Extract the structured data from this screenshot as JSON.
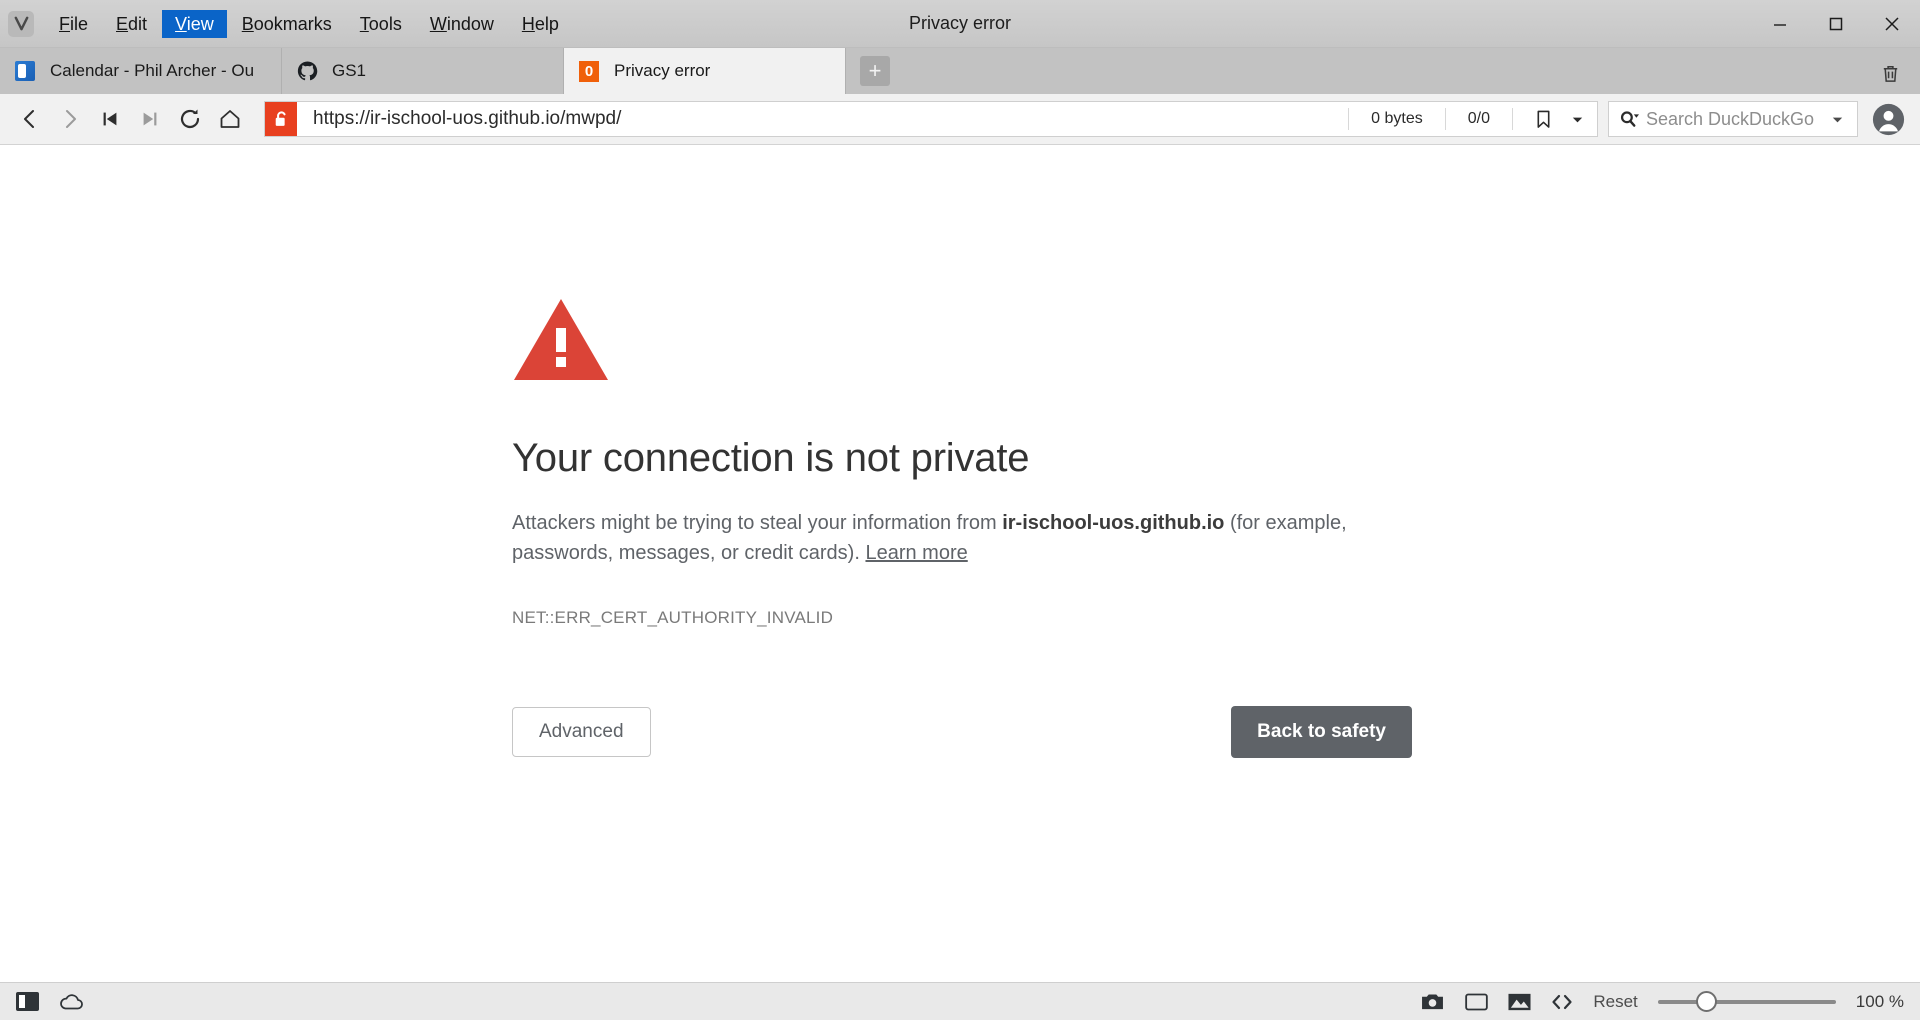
{
  "window": {
    "title": "Privacy error",
    "minimize_label": "Minimize",
    "maximize_label": "Maximize",
    "close_label": "Close"
  },
  "menubar": {
    "logo_icon": "vivaldi-logo-icon",
    "items": [
      {
        "label": "File",
        "mnemonic": "F",
        "rest": "ile",
        "active": false
      },
      {
        "label": "Edit",
        "mnemonic": "E",
        "rest": "dit",
        "active": false
      },
      {
        "label": "View",
        "mnemonic": "V",
        "rest": "iew",
        "active": true
      },
      {
        "label": "Bookmarks",
        "mnemonic": "B",
        "rest": "ookmarks",
        "active": false
      },
      {
        "label": "Tools",
        "mnemonic": "T",
        "rest": "ools",
        "active": false
      },
      {
        "label": "Window",
        "mnemonic": "W",
        "rest": "indow",
        "active": false
      },
      {
        "label": "Help",
        "mnemonic": "H",
        "rest": "elp",
        "active": false
      }
    ]
  },
  "tabs": {
    "items": [
      {
        "title": "Calendar - Phil Archer - Ou",
        "favicon": "outlook-icon",
        "active": false
      },
      {
        "title": "GS1",
        "favicon": "github-icon",
        "active": false
      },
      {
        "title": "Privacy error",
        "favicon": "orange-zero-icon",
        "active": true
      }
    ],
    "new_tab_label": "+",
    "trash_icon": "trash-icon"
  },
  "toolbar": {
    "back_icon": "back-arrow-icon",
    "forward_icon": "forward-arrow-icon",
    "rewind_icon": "rewind-icon",
    "fastforward_icon": "fast-forward-icon",
    "reload_icon": "reload-icon",
    "home_icon": "home-icon",
    "ssl_icon": "open-padlock-icon",
    "url": "https://ir-ischool-uos.github.io/mwpd/",
    "bytes_loaded": "0 bytes",
    "blocked_count": "0/0",
    "bookmark_icon": "bookmark-icon",
    "bookmark_caret_icon": "chevron-down-icon",
    "search_icon": "search-icon",
    "search_placeholder": "Search DuckDuckGo",
    "search_value": "",
    "search_caret_icon": "chevron-down-icon",
    "profile_icon": "profile-avatar-icon"
  },
  "error_page": {
    "warning_icon": "warning-triangle-icon",
    "warning_color": "#DB4437",
    "title": "Your connection is not private",
    "body_before": "Attackers might be trying to steal your information from ",
    "body_domain": "ir-ischool-uos.github.io",
    "body_after": " (for example, passwords, messages, or credit cards). ",
    "learn_more": "Learn more",
    "error_code": "NET::ERR_CERT_AUTHORITY_INVALID",
    "advanced_button": "Advanced",
    "back_to_safety_button": "Back to safety"
  },
  "statusbar": {
    "panel_toggle_icon": "panel-toggle-icon",
    "cloud_icon": "cloud-icon",
    "capture_icon": "camera-icon",
    "tiling_icon": "tiling-icon",
    "image_icon": "image-icon",
    "developer_icon": "code-icon",
    "reset_label": "Reset",
    "zoom_value": "100 %"
  }
}
